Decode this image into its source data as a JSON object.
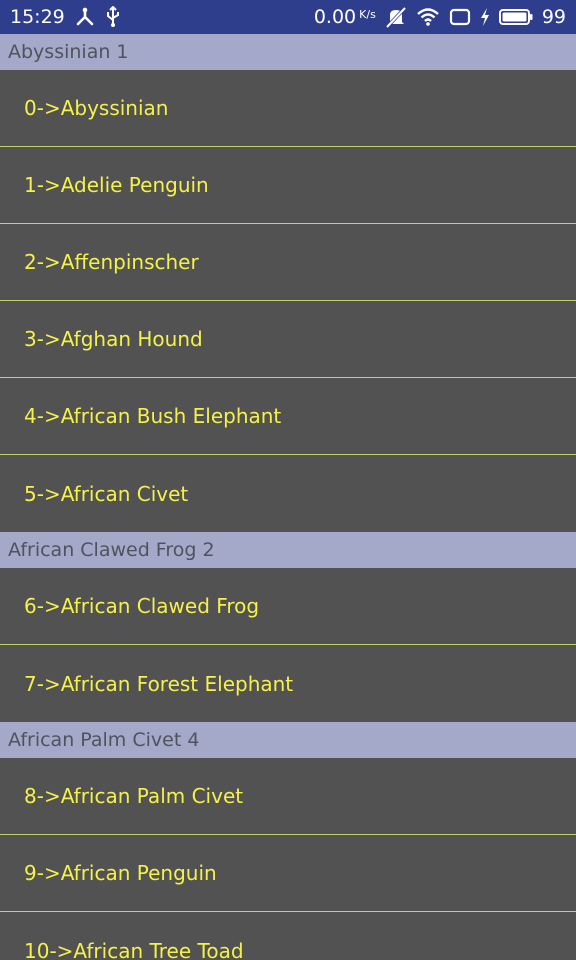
{
  "status_bar": {
    "time": "15:29",
    "speed_value": "0.00",
    "speed_unit": "K/s",
    "battery_level": "99",
    "icons": [
      "usb-debug-icon",
      "usb-icon",
      "mute-icon",
      "wifi-icon",
      "screen-rotation-icon",
      "charging-icon",
      "battery-icon"
    ],
    "background_color": "#2e3e8d"
  },
  "colors": {
    "list_background": "#525252",
    "item_text": "#f4f24a",
    "divider": "#c6d06a",
    "header_background": "#a4a9c9",
    "header_text": "#50535d"
  },
  "sections": [
    {
      "header": "Abyssinian 1",
      "items": [
        "0->Abyssinian",
        "1->Adelie Penguin",
        "2->Affenpinscher",
        "3->Afghan Hound",
        "4->African Bush Elephant",
        "5->African Civet"
      ]
    },
    {
      "header": "African Clawed Frog 2",
      "items": [
        "6->African Clawed Frog",
        "7->African Forest Elephant"
      ]
    },
    {
      "header": "African Palm Civet 4",
      "items": [
        "8->African Palm Civet",
        "9->African Penguin",
        "10->African Tree Toad"
      ]
    }
  ]
}
